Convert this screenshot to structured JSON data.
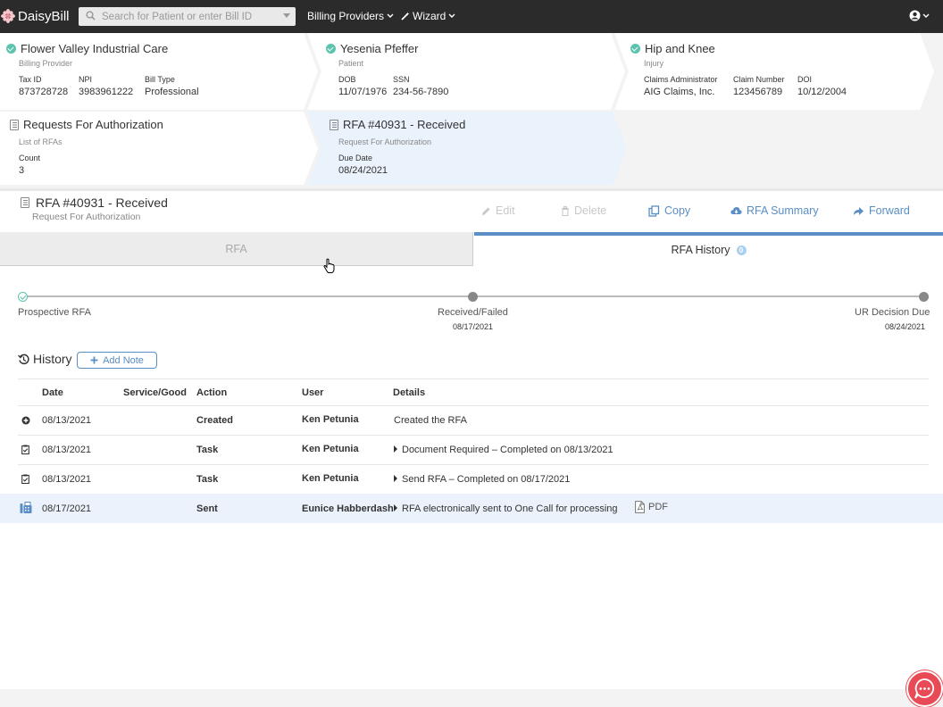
{
  "nav": {
    "brand": "DaisyBill",
    "search_placeholder": "Search for Patient or enter Bill ID",
    "billing_providers": "Billing Providers",
    "wizard": "Wizard"
  },
  "context": {
    "provider": {
      "title": "Flower Valley Industrial Care",
      "subtitle": "Billing Provider",
      "f1_label": "Tax ID",
      "f1_value": "873728728",
      "f2_label": "NPI",
      "f2_value": "3983961222",
      "f3_label": "Bill Type",
      "f3_value": "Professional"
    },
    "patient": {
      "title": "Yesenia Pfeffer",
      "subtitle": "Patient",
      "f1_label": "DOB",
      "f1_value": "11/07/1976",
      "f2_label": "SSN",
      "f2_value": "234-56-7890"
    },
    "injury": {
      "title": "Hip and Knee",
      "subtitle": "Injury",
      "f1_label": "Claims Administrator",
      "f1_value": "AIG Claims, Inc.",
      "f2_label": "Claim Number",
      "f2_value": "123456789",
      "f3_label": "DOI",
      "f3_value": "10/12/2004"
    },
    "rfas": {
      "title": "Requests For Authorization",
      "subtitle": "List of RFAs",
      "f1_label": "Count",
      "f1_value": "3"
    },
    "rfa": {
      "title": "RFA #40931 - Received",
      "subtitle": "Request For Authorization",
      "f1_label": "Due Date",
      "f1_value": "08/24/2021"
    }
  },
  "page": {
    "title": "RFA #40931 - Received",
    "subtitle": "Request For Authorization",
    "actions": {
      "edit": "Edit",
      "delete": "Delete",
      "copy": "Copy",
      "summary": "RFA Summary",
      "forward": "Forward"
    }
  },
  "tabs": {
    "rfa": "RFA",
    "history": "RFA History",
    "history_badge": "0"
  },
  "timeline": {
    "steps": [
      {
        "label": "Prospective RFA",
        "date": ""
      },
      {
        "label": "Received/Failed",
        "date": "08/17/2021"
      },
      {
        "label": "UR Decision Due",
        "date": "08/24/2021"
      }
    ]
  },
  "history": {
    "title": "History",
    "add_note": "Add Note",
    "columns": [
      "Date",
      "Service/Good",
      "Action",
      "User",
      "Details"
    ],
    "rows": [
      {
        "icon": "plus-circle-icon",
        "date": "08/13/2021",
        "service": "",
        "action": "Created",
        "user": "Ken Petunia",
        "details": "Created the RFA",
        "pdf": ""
      },
      {
        "icon": "clipboard-check-icon",
        "date": "08/13/2021",
        "service": "",
        "action": "Task",
        "user": "Ken Petunia",
        "details": "Document Required – Completed on 08/13/2021",
        "pdf": ""
      },
      {
        "icon": "clipboard-check-icon",
        "date": "08/13/2021",
        "service": "",
        "action": "Task",
        "user": "Ken Petunia",
        "details": "Send RFA – Completed on 08/17/2021",
        "pdf": ""
      },
      {
        "icon": "fax-icon",
        "date": "08/17/2021",
        "service": "",
        "action": "Sent",
        "user": "Eunice Habberdash",
        "details": "RFA electronically sent to One Call for processing",
        "pdf": "PDF"
      }
    ]
  },
  "colors": {
    "accent": "#5a8ec4",
    "success": "#5cc4ae",
    "chat": "#e84a56",
    "highlight_row": "#ebf2fb"
  }
}
